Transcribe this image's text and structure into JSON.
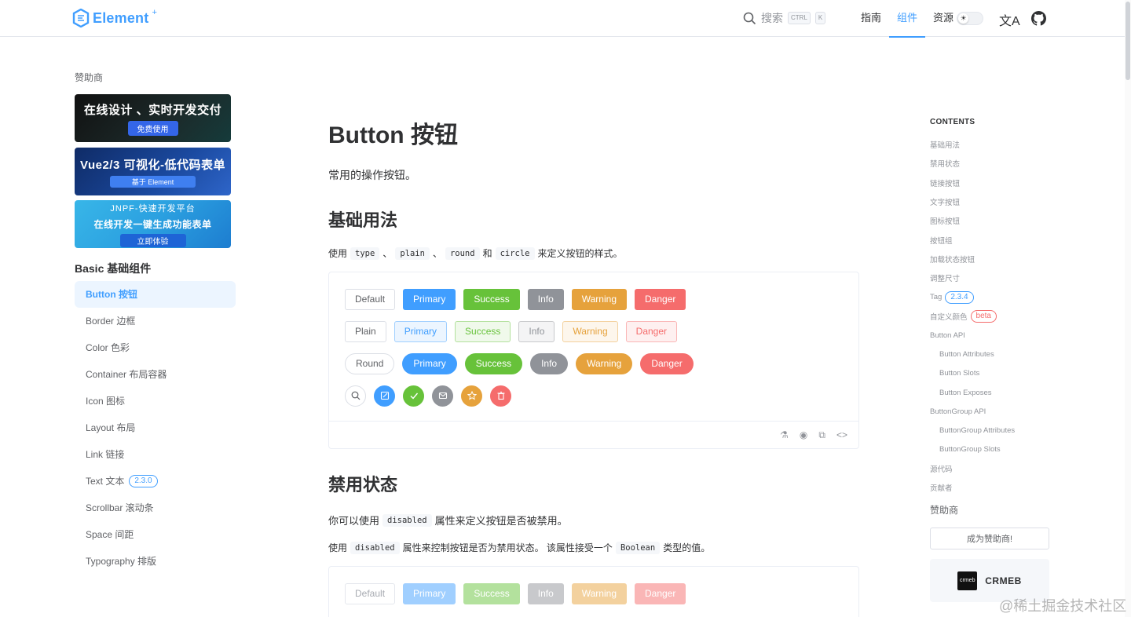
{
  "header": {
    "logo_text": "Element",
    "logo_plus": "+",
    "search_placeholder": "搜索",
    "kbd_ctrl": "CTRL",
    "kbd_k": "K",
    "nav": [
      "指南",
      "组件",
      "资源"
    ],
    "active_nav": "组件"
  },
  "sidebar": {
    "sponsor_title": "赞助商",
    "banners": [
      {
        "title": "在线设计 、实时开发交付",
        "sub": "免费使用"
      },
      {
        "title": "Vue2/3 可视化-低代码表单",
        "sub": "基于 Element"
      },
      {
        "top": "JNPF-快速开发平台",
        "title": "在线开发一键生成功能表单",
        "sub": "立即体验"
      }
    ],
    "group_title": "Basic 基础组件",
    "menu": [
      {
        "label": "Button 按钮"
      },
      {
        "label": "Border 边框"
      },
      {
        "label": "Color 色彩"
      },
      {
        "label": "Container 布局容器"
      },
      {
        "label": "Icon 图标"
      },
      {
        "label": "Layout 布局"
      },
      {
        "label": "Link 链接"
      },
      {
        "label": "Text 文本",
        "badge": "2.3.0"
      },
      {
        "label": "Scrollbar 滚动条"
      },
      {
        "label": "Space 间距"
      },
      {
        "label": "Typography 排版"
      }
    ]
  },
  "main": {
    "title": "Button 按钮",
    "description": "常用的操作按钮。",
    "section1_title": "基础用法",
    "section1_text": {
      "pre": "使用",
      "code1": "type",
      "sep1": "、",
      "code2": "plain",
      "sep2": "、",
      "code3": "round",
      "and": "和",
      "code4": "circle",
      "post": "来定义按钮的样式。"
    },
    "row_default": [
      "Default",
      "Primary",
      "Success",
      "Info",
      "Warning",
      "Danger"
    ],
    "row_plain": [
      "Plain",
      "Primary",
      "Success",
      "Info",
      "Warning",
      "Danger"
    ],
    "row_round": [
      "Round",
      "Primary",
      "Success",
      "Info",
      "Warning",
      "Danger"
    ],
    "row_circle_icons": [
      "search-icon",
      "edit-icon",
      "check-icon",
      "message-icon",
      "star-icon",
      "delete-icon"
    ],
    "section2_title": "禁用状态",
    "section2_text1": {
      "pre": "你可以使用",
      "code": "disabled",
      "post": "属性来定义按钮是否被禁用。"
    },
    "section2_text2": {
      "pre": "使用",
      "code": "disabled",
      "mid": "属性来控制按钮是否为禁用状态。 该属性接受一个",
      "code2": "Boolean",
      "post": "类型的值。"
    },
    "row_disabled": [
      "Default",
      "Primary",
      "Success",
      "Info",
      "Warning",
      "Danger"
    ]
  },
  "toc": {
    "head": "CONTENTS",
    "items": [
      {
        "label": "基础用法"
      },
      {
        "label": "禁用状态"
      },
      {
        "label": "链接按钮"
      },
      {
        "label": "文字按钮"
      },
      {
        "label": "图标按钮"
      },
      {
        "label": "按钮组"
      },
      {
        "label": "加载状态按钮"
      },
      {
        "label": "调整尺寸"
      },
      {
        "label": "Tag",
        "badge": "2.3.4"
      },
      {
        "label": "自定义颜色",
        "badge": "beta"
      },
      {
        "label": "Button API"
      },
      {
        "label": "Button Attributes",
        "sub": true
      },
      {
        "label": "Button Slots",
        "sub": true
      },
      {
        "label": "Button Exposes",
        "sub": true
      },
      {
        "label": "ButtonGroup API"
      },
      {
        "label": "ButtonGroup Attributes",
        "sub": true
      },
      {
        "label": "ButtonGroup Slots",
        "sub": true
      },
      {
        "label": "源代码"
      },
      {
        "label": "贡献者"
      }
    ],
    "sponsor_title": "赞助商",
    "sponsor_button": "成为赞助商!",
    "sponsor_card": "CRMEB",
    "sponsor_logo": "crmeb"
  },
  "watermark": "@稀土掘金技术社区",
  "colors": {
    "primary": "#409eff",
    "success": "#67c23a",
    "info": "#909399",
    "warning": "#e6a23c",
    "danger": "#f56c6c"
  }
}
